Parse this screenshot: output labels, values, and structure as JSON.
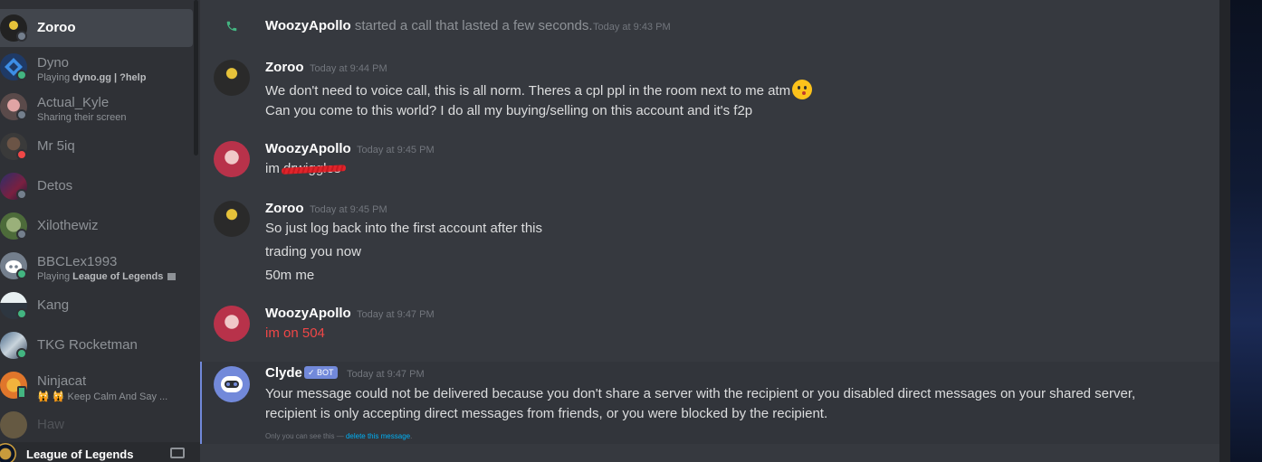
{
  "sidebar": {
    "dms": [
      {
        "name": "Zoroo",
        "sub": "",
        "status": "offline",
        "active": true
      },
      {
        "name": "Dyno",
        "sub_prefix": "Playing ",
        "sub_bold": "dyno.gg | ?help",
        "status": "online"
      },
      {
        "name": "Actual_Kyle",
        "sub": "Sharing their screen",
        "status": "offline"
      },
      {
        "name": "Mr 5iq",
        "sub": "",
        "status": "dnd"
      },
      {
        "name": "Detos",
        "sub": "",
        "status": "offline"
      },
      {
        "name": "Xilothewiz",
        "sub": "",
        "status": "offline"
      },
      {
        "name": "BBCLex1993",
        "sub_prefix": "Playing ",
        "sub_bold": "League of Legends",
        "status": "online"
      },
      {
        "name": "Kang",
        "sub": "",
        "status": "online"
      },
      {
        "name": "TKG Rocketman",
        "sub": "",
        "status": "online"
      },
      {
        "name": "Ninjacat",
        "sub": "🙀 🙀 Keep Calm And Say ...",
        "status": "mobile"
      },
      {
        "name": "Haw",
        "sub": "",
        "status": "offline"
      }
    ],
    "footer": {
      "guild_name": "League of Legends"
    }
  },
  "chat": {
    "system_call": {
      "user": "WoozyApollo",
      "text": " started a call that lasted a few seconds.",
      "timestamp": "Today at 9:43 PM"
    },
    "messages": [
      {
        "author": "Zoroo",
        "timestamp": "Today at 9:44 PM",
        "lines": [
          "We don't need to voice call, this is all norm. Theres a cpl ppl in the room next to me atm",
          "Can you come to this world? I do all my buying/selling on this account and it's f2p"
        ]
      },
      {
        "author": "WoozyApollo",
        "timestamp": "Today at 9:45 PM",
        "prefix": "im ",
        "struck": "drwiggles"
      },
      {
        "author": "Zoroo",
        "timestamp": "Today at 9:45 PM",
        "lines": [
          "So just log back into the first account after this",
          "trading you now",
          "50m me"
        ]
      },
      {
        "author": "WoozyApollo",
        "timestamp": "Today at 9:47 PM",
        "lines": [
          "im on 504"
        ]
      },
      {
        "author": "Clyde",
        "bot_tag": "✓ BOT",
        "timestamp": "Today at 9:47 PM",
        "lines": [
          "Your message could not be delivered because you don't share a server with the recipient or you disabled direct messages on your shared server,",
          "recipient is only accepting direct messages from friends, or you were blocked by the recipient."
        ],
        "ephemeral_text": "Only you can see this — ",
        "ephemeral_link": "delete this message",
        "ephemeral_end": "."
      }
    ]
  },
  "colors": {
    "accent": "#7289da",
    "online": "#43b581",
    "dnd": "#f04747",
    "offline": "#747f8d",
    "link": "#00b0f4"
  }
}
